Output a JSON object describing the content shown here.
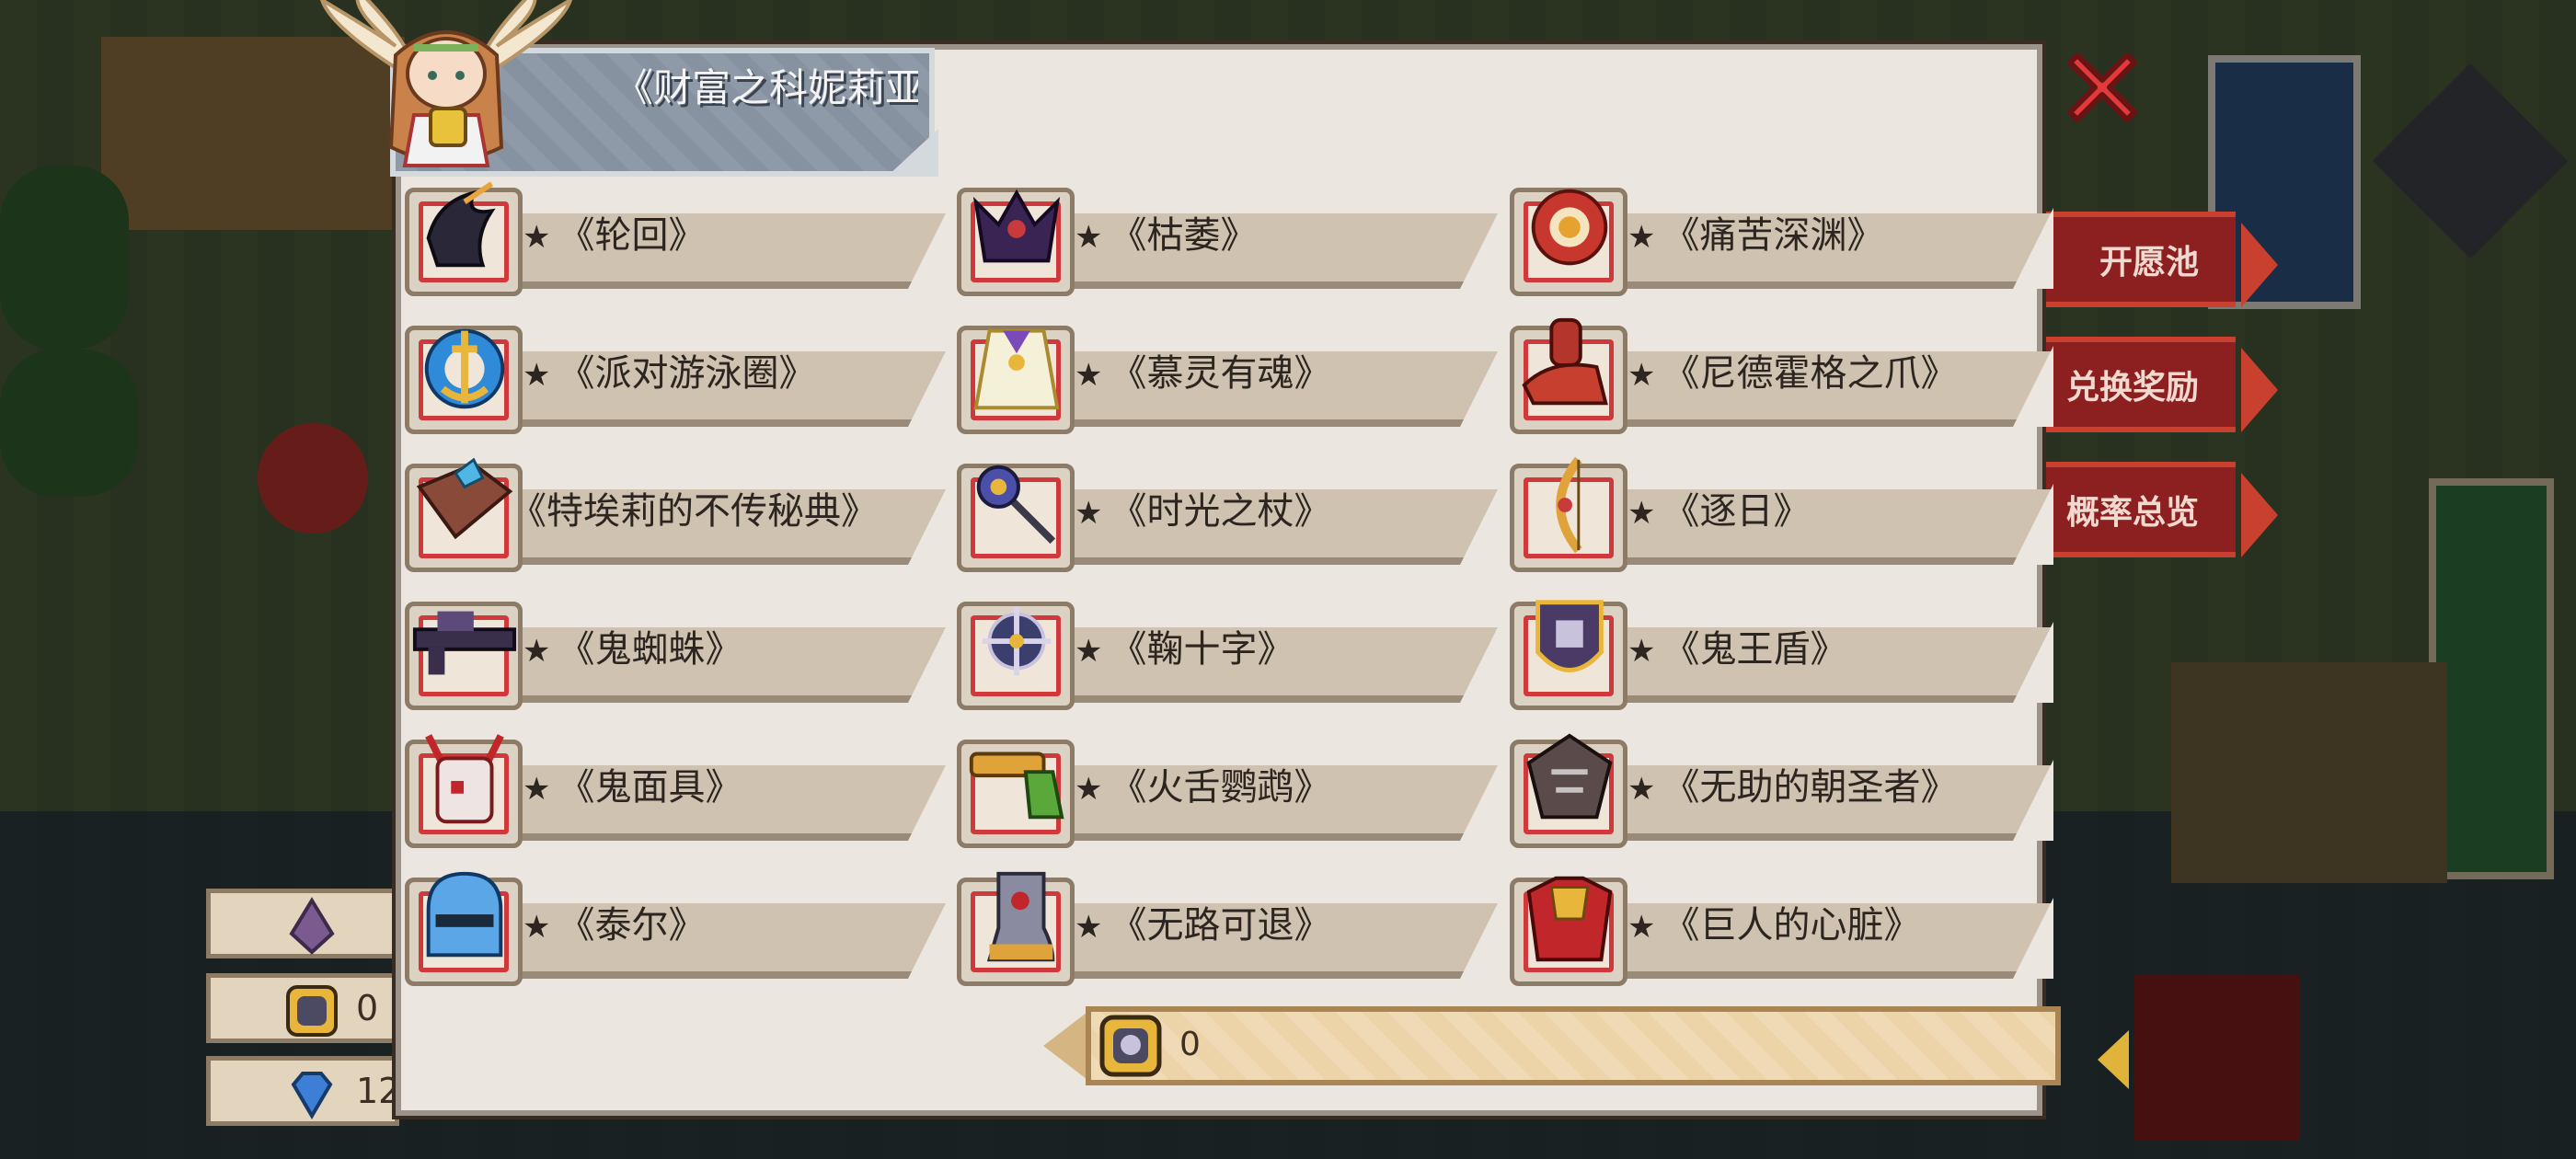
{
  "header": {
    "title": "《财富之科妮莉亚》"
  },
  "side_menu": {
    "items": [
      "开愿池",
      "兑换奖励",
      "概率总览"
    ]
  },
  "left_counters": [
    "",
    "0",
    "12"
  ],
  "star_symbol": "★",
  "items": [
    {
      "name": "《轮回》",
      "icon": "dark-claw-icon"
    },
    {
      "name": "《枯萎》",
      "icon": "dark-creature-icon"
    },
    {
      "name": "《痛苦深渊》",
      "icon": "eye-orb-icon"
    },
    {
      "name": "《派对游泳圈》",
      "icon": "anchor-ring-icon"
    },
    {
      "name": "《慕灵有魂》",
      "icon": "robe-icon"
    },
    {
      "name": "《尼德霍格之爪》",
      "icon": "red-claw-icon"
    },
    {
      "name": "《特埃莉的不传秘典》",
      "icon": "spellbook-icon"
    },
    {
      "name": "《时光之杖》",
      "icon": "staff-icon"
    },
    {
      "name": "《逐日》",
      "icon": "bow-icon"
    },
    {
      "name": "《鬼蜘蛛》",
      "icon": "rifle-icon"
    },
    {
      "name": "《鞠十字》",
      "icon": "shuriken-icon"
    },
    {
      "name": "《鬼王盾》",
      "icon": "shield-icon"
    },
    {
      "name": "《鬼面具》",
      "icon": "demon-mask-icon"
    },
    {
      "name": "《火舌鹦鹉》",
      "icon": "pistol-icon"
    },
    {
      "name": "《无助的朝圣者》",
      "icon": "spiked-helm-icon"
    },
    {
      "name": "《泰尔》",
      "icon": "knight-helm-icon"
    },
    {
      "name": "《无路可退》",
      "icon": "boot-icon"
    },
    {
      "name": "《巨人的心脏》",
      "icon": "armor-icon"
    }
  ],
  "currency": {
    "value": "0",
    "icon": "coin-token-icon"
  },
  "colors": {
    "panel_bg": "#ebe7e0",
    "slot_border": "#d0393b",
    "header_bg": "#8e9aa8",
    "close_red": "#e03a3a"
  }
}
